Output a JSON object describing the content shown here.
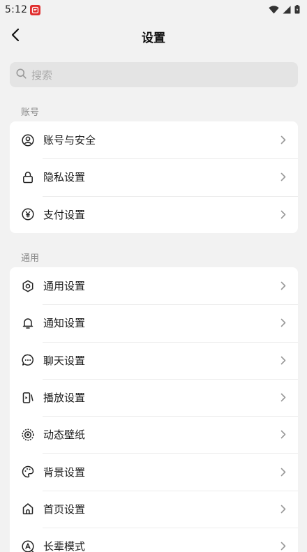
{
  "status_bar": {
    "time": "5:12",
    "notification_icon": "news-app-icon",
    "icons": [
      "wifi-icon",
      "signal-icon",
      "battery-icon"
    ]
  },
  "header": {
    "title": "设置",
    "back_icon": "back-arrow-icon"
  },
  "search": {
    "placeholder": "搜索"
  },
  "sections": [
    {
      "label": "账号",
      "items": [
        {
          "label": "账号与安全",
          "icon": "user-circle-icon"
        },
        {
          "label": "隐私设置",
          "icon": "lock-icon"
        },
        {
          "label": "支付设置",
          "icon": "yen-circle-icon"
        }
      ]
    },
    {
      "label": "通用",
      "items": [
        {
          "label": "通用设置",
          "icon": "gear-icon"
        },
        {
          "label": "通知设置",
          "icon": "bell-icon"
        },
        {
          "label": "聊天设置",
          "icon": "chat-bubble-icon"
        },
        {
          "label": "播放设置",
          "icon": "play-device-icon"
        },
        {
          "label": "动态壁纸",
          "icon": "dynamic-wallpaper-icon"
        },
        {
          "label": "背景设置",
          "icon": "palette-icon"
        },
        {
          "label": "首页设置",
          "icon": "home-icon"
        },
        {
          "label": "长辈模式",
          "icon": "elder-mode-icon"
        }
      ]
    }
  ],
  "colors": {
    "background": "#f2f2f2",
    "card": "#ffffff",
    "search_bg": "#e4e4e4",
    "notification_badge": "#e02d2d"
  }
}
